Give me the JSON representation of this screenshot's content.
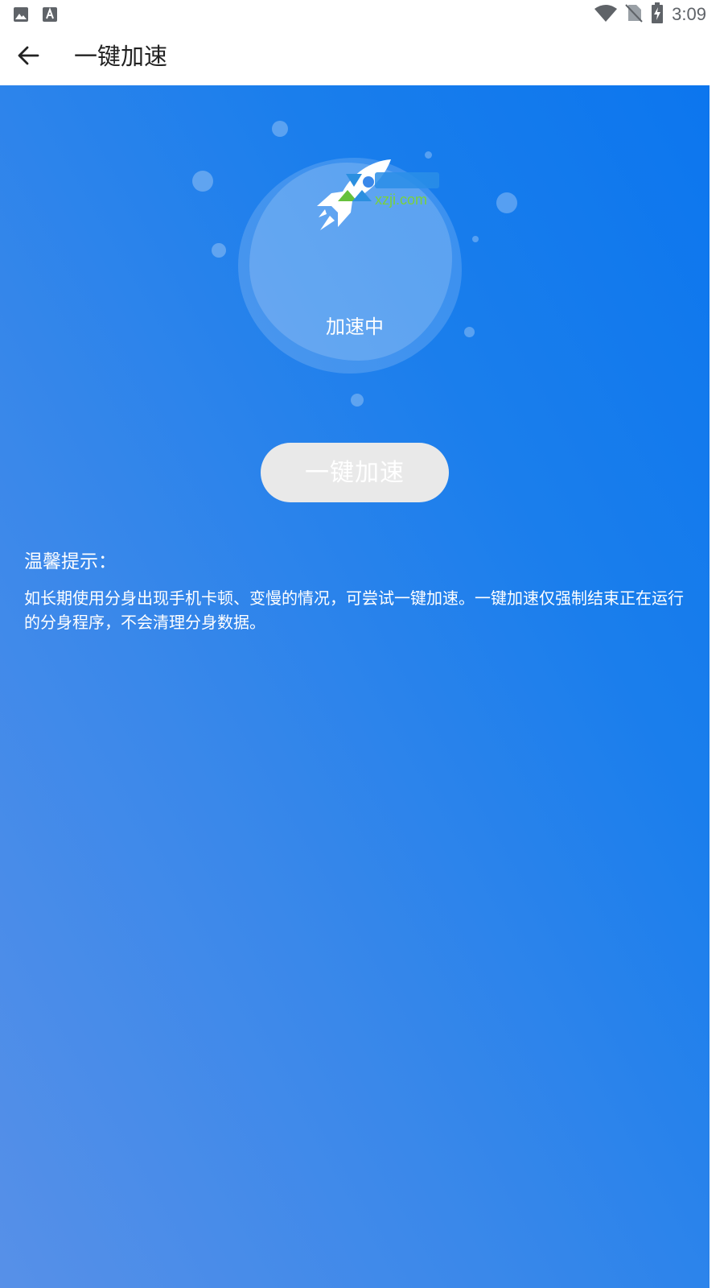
{
  "status_bar": {
    "time": "3:09",
    "left_icons": [
      "image-icon",
      "font-icon"
    ],
    "right_icons": [
      "wifi-icon",
      "no-sim-icon",
      "battery-charging-icon"
    ]
  },
  "app_bar": {
    "title": "一键加速",
    "back_icon": "arrow-back-icon"
  },
  "hero": {
    "status_text": "加速中",
    "icon": "rocket-icon",
    "watermark_icon": "xzji-watermark"
  },
  "action": {
    "boost_button_label": "一键加速"
  },
  "tips": {
    "title": "温馨提示：",
    "body": "如长期使用分身出现手机卡顿、变慢的情况，可尝试一键加速。一键加速仅强制结束正在运行的分身程序，不会清理分身数据。"
  },
  "colors": {
    "gradient_start": "#5790e8",
    "gradient_end": "#0c76ee",
    "button_bg": "#e9e9e9",
    "text_on_blue": "#ffffff"
  }
}
